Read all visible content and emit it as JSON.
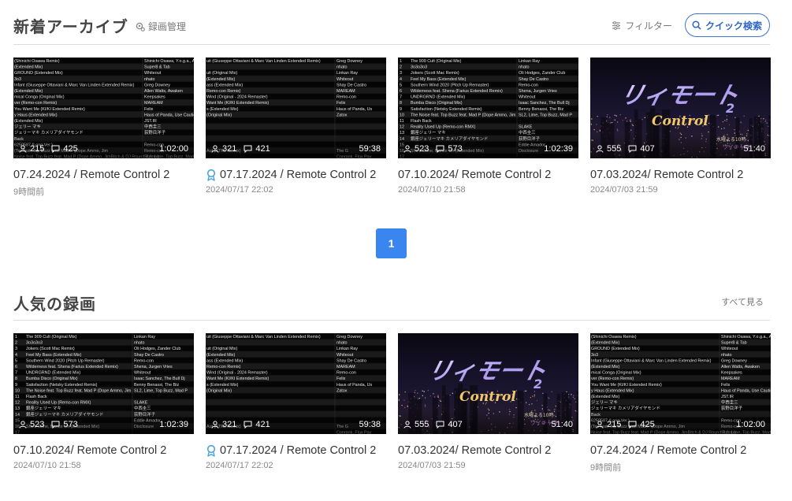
{
  "new_archive": {
    "title": "新着アーカイブ",
    "manage_label": "録画管理",
    "filter_label": "フィルター",
    "quick_search_label": "クイック検索",
    "cards": [
      {
        "variant": "tracklist-a",
        "viewers": "215",
        "comments": "425",
        "duration": "1:02:00",
        "title": "07.24.2024 / Remote Control 2",
        "date": "9時間前",
        "badge": false
      },
      {
        "variant": "tracklist-b",
        "viewers": "321",
        "comments": "421",
        "duration": "59:38",
        "title": "07.17.2024 / Remote Control 2",
        "date": "2024/07/17 22:02",
        "badge": true
      },
      {
        "variant": "tracklist-c",
        "viewers": "523",
        "comments": "573",
        "duration": "1:02:39",
        "title": "07.10.2024/ Remote Control 2",
        "date": "2024/07/10 21:58",
        "badge": false
      },
      {
        "variant": "logo",
        "viewers": "555",
        "comments": "407",
        "duration": "51:40",
        "title": "07.03.2024/ Remote Control 2",
        "date": "2024/07/03 21:59",
        "badge": false
      }
    ]
  },
  "pagination": {
    "current": "1"
  },
  "popular": {
    "title": "人気の録画",
    "see_all_label": "すべて見る",
    "cards": [
      {
        "variant": "tracklist-c",
        "viewers": "523",
        "comments": "573",
        "duration": "1:02:39",
        "title": "07.10.2024/ Remote Control 2",
        "date": "2024/07/10 21:58",
        "badge": false
      },
      {
        "variant": "tracklist-b",
        "viewers": "321",
        "comments": "421",
        "duration": "59:38",
        "title": "07.17.2024 / Remote Control 2",
        "date": "2024/07/17 22:02",
        "badge": true
      },
      {
        "variant": "logo",
        "viewers": "555",
        "comments": "407",
        "duration": "51:40",
        "title": "07.03.2024/ Remote Control 2",
        "date": "2024/07/03 21:59",
        "badge": false
      },
      {
        "variant": "tracklist-a",
        "viewers": "215",
        "comments": "425",
        "duration": "1:02:00",
        "title": "07.24.2024 / Remote Control 2",
        "date": "9時間前",
        "badge": false
      }
    ]
  },
  "tracklists": {
    "tracklist-a": [
      [
        "(Shinichi Osawa Remix)",
        "Shinichi Osawa, Y.o.g.a., Avio"
      ],
      [
        "(Extended Mix)",
        "Super8 & Tab"
      ],
      [
        "GROUND (Extended Mix)",
        "Whiteout"
      ],
      [
        "3o3",
        "nhato"
      ],
      [
        "Infant (Giuseppe Ottaviani & Marc Van Linden Extended Remix)",
        "Greg Downey"
      ],
      [
        "(Extended Mix)",
        "Allen Watts, Awaken"
      ],
      [
        "mical Conga (Original Mix)",
        "Keepsakes"
      ],
      [
        "ver (Remo-con Remix)",
        "MAREAM"
      ],
      [
        "You Want Me (KI/KI Extended Remix)",
        "Felix"
      ],
      [
        "y Haus (Extended Mix)",
        "Haus of Panda, Use Caution"
      ],
      [
        "(Extended Mix)",
        "JST.IR"
      ],
      [
        "ジェリー マキ",
        "中西圭三"
      ],
      [
        "ジェリーマキ カメリアダイヤモンド",
        "荻野目洋子"
      ],
      [
        "Back",
        ""
      ],
      [
        "6250587 (Long Ver.)",
        "Remo-con"
      ],
      [
        "(Tex feat. Top Buzz feat. Mad P (Dope Ammo, Jim",
        "Remo-con"
      ],
      [
        "Noise feat. Top Buzz feat. Mad P (Dope Ammo, JimBitch & DJ Round Remix)",
        "SL2, Lime, Top Buzz, Mad P"
      ]
    ],
    "tracklist-b": [
      [
        "uit (Giuseppe Ottaviani & Marc Van Linden Extended Remix)",
        "Greg Downey"
      ],
      [
        "",
        "nhato"
      ],
      [
        "uit (Original Mix)",
        "Linkan Ray"
      ],
      [
        "(Extended Mix)",
        "Whiteout"
      ],
      [
        "ass (Extended Mix)",
        "Shay De Castro"
      ],
      [
        "Remo-con Remix)",
        "MAREAM"
      ],
      [
        "Wind (Original - 2024 Remaster)",
        "Remo-con"
      ],
      [
        "Want Me (KI/KI Extended Remix)",
        "Felix"
      ],
      [
        "s (Extended Mix)",
        "Haus of Panda, Us"
      ],
      [
        "(Original Mix)",
        "Zatox"
      ],
      [
        "",
        ""
      ],
      [
        "",
        ""
      ],
      [
        "",
        ""
      ],
      [
        "",
        ""
      ],
      [
        "",
        ""
      ],
      [
        "Aut (KTRL Remix)",
        "The G"
      ],
      [
        "",
        "Conrank, Flux Pav"
      ]
    ],
    "tracklist-c": [
      [
        "The 909 Cult (Original Mix)",
        "Linkan Ray"
      ],
      [
        "3o3o3o3",
        "nhato"
      ],
      [
        "Jokers (Scott Mac Remix)",
        "Oli Hodges, Zander Club"
      ],
      [
        "Feel My Bass (Extended Mix)",
        "Shay De Castro"
      ],
      [
        "Southern Wind 2020 (Pitch Up Remaster)",
        "Remo-con"
      ],
      [
        "Wilderness feat. Shena (Farius Extended Remix)",
        "Shena, Jurgen Vries"
      ],
      [
        "UNDRGRND (Extended Mix)",
        "Whiteout"
      ],
      [
        "Bumba Disco (Original Mix)",
        "Isaac Sanchez, The Bull Dj"
      ],
      [
        "Satisfaction (Netsky Extended Remix)",
        "Benny Benassi, The Biz"
      ],
      [
        "The Noise feat. Top Buzz feat. Mad P (Dope Ammo, Jim",
        "SL2, Lime, Top Buzz, Mad P"
      ],
      [
        "Flash Back",
        ""
      ],
      [
        "Reality Used Up (Remo-con RMX)",
        "SLAKE"
      ],
      [
        "銀座ジェリー マキ",
        "中西圭三"
      ],
      [
        "銀座ジェリーマキ カメリアダイヤモンド",
        "荻野目洋子"
      ],
      [
        "",
        "Eddie Amador"
      ],
      [
        "She's Gone, Dance On (Extended Mix)",
        "Disclosure"
      ],
      [
        "",
        ""
      ]
    ]
  },
  "logo": {
    "line1": "リィモート",
    "sub": "2",
    "line2": "Control",
    "caption": "水曜よる10時",
    "caption2": "ツイキャス"
  }
}
